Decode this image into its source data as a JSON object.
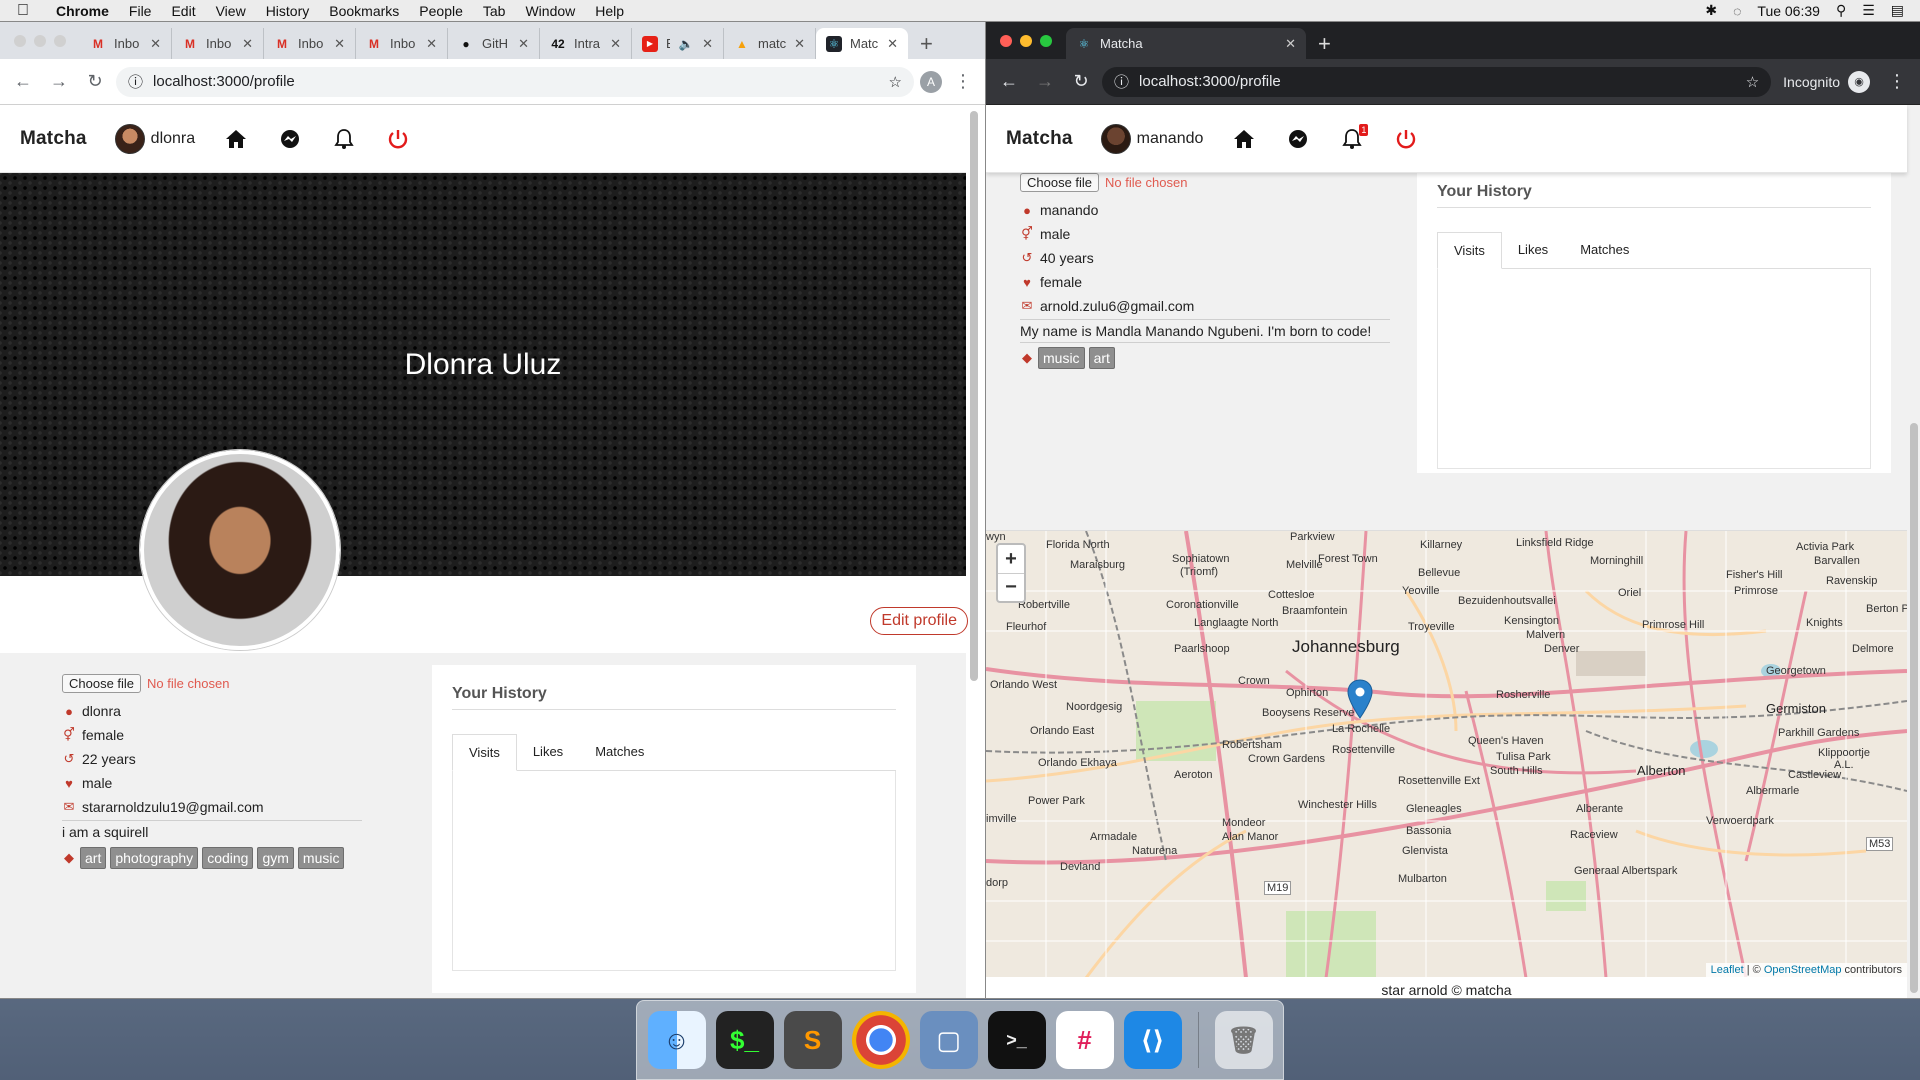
{
  "menubar": {
    "app": "Chrome",
    "items": [
      "File",
      "Edit",
      "View",
      "History",
      "Bookmarks",
      "People",
      "Tab",
      "Window",
      "Help"
    ],
    "clock": "Tue 06:39"
  },
  "left_window": {
    "tabs": [
      {
        "icon": "gmail-icon",
        "label": "Inbo"
      },
      {
        "icon": "gmail-icon",
        "label": "Inbo"
      },
      {
        "icon": "gmail-icon",
        "label": "Inbo"
      },
      {
        "icon": "gmail-icon",
        "label": "Inbo"
      },
      {
        "icon": "github-icon",
        "label": "GitH"
      },
      {
        "icon": "intra-icon",
        "label": "Intra"
      },
      {
        "icon": "youtube-icon",
        "label": "E"
      },
      {
        "icon": "firebase-icon",
        "label": "matc"
      },
      {
        "icon": "react-icon",
        "label": "Matc"
      }
    ],
    "url": "localhost:3000/profile",
    "account_initial": "A"
  },
  "right_window": {
    "tab": {
      "label": "Matcha"
    },
    "url": "localhost:3000/profile",
    "incognito_label": "Incognito"
  },
  "app_left": {
    "brand": "Matcha",
    "username": "dlonra",
    "cover_name": "Dlonra Uluz",
    "edit_profile": "Edit profile",
    "file_button": "Choose file",
    "file_status": "No file chosen",
    "info": {
      "username": "dlonra",
      "gender": "female",
      "age": "22 years",
      "preference": "male",
      "email": "stararnoldzulu19@gmail.com"
    },
    "bio": "i am a squirell",
    "tags": [
      "art",
      "photography",
      "coding",
      "gym",
      "music"
    ],
    "history": {
      "title": "Your History",
      "tabs": [
        "Visits",
        "Likes",
        "Matches"
      ]
    }
  },
  "app_right": {
    "brand": "Matcha",
    "username": "manando",
    "notification_count": "1",
    "file_button": "Choose file",
    "file_status": "No file chosen",
    "info": {
      "username": "manando",
      "gender": "male",
      "age": "40 years",
      "preference": "female",
      "email": "arnold.zulu6@gmail.com"
    },
    "bio": "My name is Mandla Manando Ngubeni. I'm born to code!",
    "tags": [
      "music",
      "art"
    ],
    "history": {
      "title": "Your History",
      "tabs": [
        "Visits",
        "Likes",
        "Matches"
      ]
    },
    "map": {
      "zoom_in": "+",
      "zoom_out": "−",
      "attribution_leaflet": "Leaflet",
      "attribution_sep": " | © ",
      "attribution_osm": "OpenStreetMap",
      "attribution_tail": " contributors",
      "labels": {
        "johannesburg": "Johannesburg",
        "germiston": "Germiston",
        "alberton": "Alberton",
        "la_rochelle": "La Rochelle",
        "rosettenville": "Rosettenville",
        "florida_north": "Florida North",
        "maraisburg": "Maraisburg",
        "sophiatown": "Sophiatown",
        "triomf": "(Triomf)",
        "melville": "Melville",
        "forest_town": "Forest Town",
        "parkview": "Parkview",
        "killarney": "Killarney",
        "linksfield_ridge": "Linksfield Ridge",
        "activia_park": "Activia Park",
        "bellevue": "Bellevue",
        "yeoville": "Yeoville",
        "morninghill": "Morninghill",
        "barvallen": "Barvallen",
        "fishers_hill": "Fisher's Hill",
        "primrose": "Primrose",
        "ravenskip": "Ravenskip",
        "robertville": "Robertville",
        "coronationville": "Coronationville",
        "cottesloe": "Cottesloe",
        "braamfontein": "Braamfontein",
        "bezuidenhoutsvallei": "Bezuidenhoutsvallei",
        "oriel": "Oriel",
        "berton_park": "Berton Park",
        "fleurhof": "Fleurhof",
        "langlaagte_north": "Langlaagte North",
        "troyeville": "Troyeville",
        "kensington": "Kensington",
        "malvern": "Malvern",
        "primrose_hill": "Primrose Hill",
        "knights": "Knights",
        "paarlshoop": "Paarlshoop",
        "denver": "Denver",
        "delmore": "Delmore",
        "orlando_west": "Orlando West",
        "crown": "Crown",
        "ophirton": "Ophirton",
        "georgetown": "Georgetown",
        "noordgesig": "Noordgesig",
        "booysens_reserve": "Booysens Reserve",
        "rosherville": "Rosherville",
        "orlando_east": "Orlando East",
        "robertsham": "Robertsham",
        "queens_haven": "Queen's Haven",
        "parkhill_gardens": "Parkhill Gardens",
        "crown_gardens": "Crown Gardens",
        "tulisa_park": "Tulisa Park",
        "klippoortje": "Klippoortje",
        "al": "A.L.",
        "orlando_ekhaya": "Orlando Ekhaya",
        "aeroton": "Aeroton",
        "south_hills": "South Hills",
        "castleview": "Castleview",
        "power_park": "Power Park",
        "winchester_hills": "Winchester Hills",
        "gleneagles": "Gleneagles",
        "alberante": "Alberante",
        "albermarle": "Albermarle",
        "rosettenville_ext": "Rosettenville Ext",
        "mondeor": "Mondeor",
        "alan_manor": "Alan Manor",
        "bassonia": "Bassonia",
        "raceview": "Raceview",
        "verwoerdpark": "Verwoerdpark",
        "armadale": "Armadale",
        "naturena": "Naturena",
        "glenvista": "Glenvista",
        "dorp": "dorp",
        "wille": "imville",
        "devland": "Devland",
        "mulbarton": "Mulbarton",
        "generaal_alberts_park": "Generaal Albertspark",
        "m53": "M53",
        "m19": "M19",
        "wyn": "wyn"
      }
    },
    "footer": "star arnold © matcha"
  },
  "dock": [
    "finder-icon",
    "terminal-icon",
    "sublime-icon",
    "chrome-icon",
    "virtualbox-icon",
    "iterm-icon",
    "slack-icon",
    "vscode-icon",
    "trash-icon"
  ],
  "colors": {
    "accent_red": "#c0392b",
    "nofile_red": "#e05a4f",
    "tag_grey": "#8f8f8f",
    "marker_blue": "#2a81cb"
  }
}
